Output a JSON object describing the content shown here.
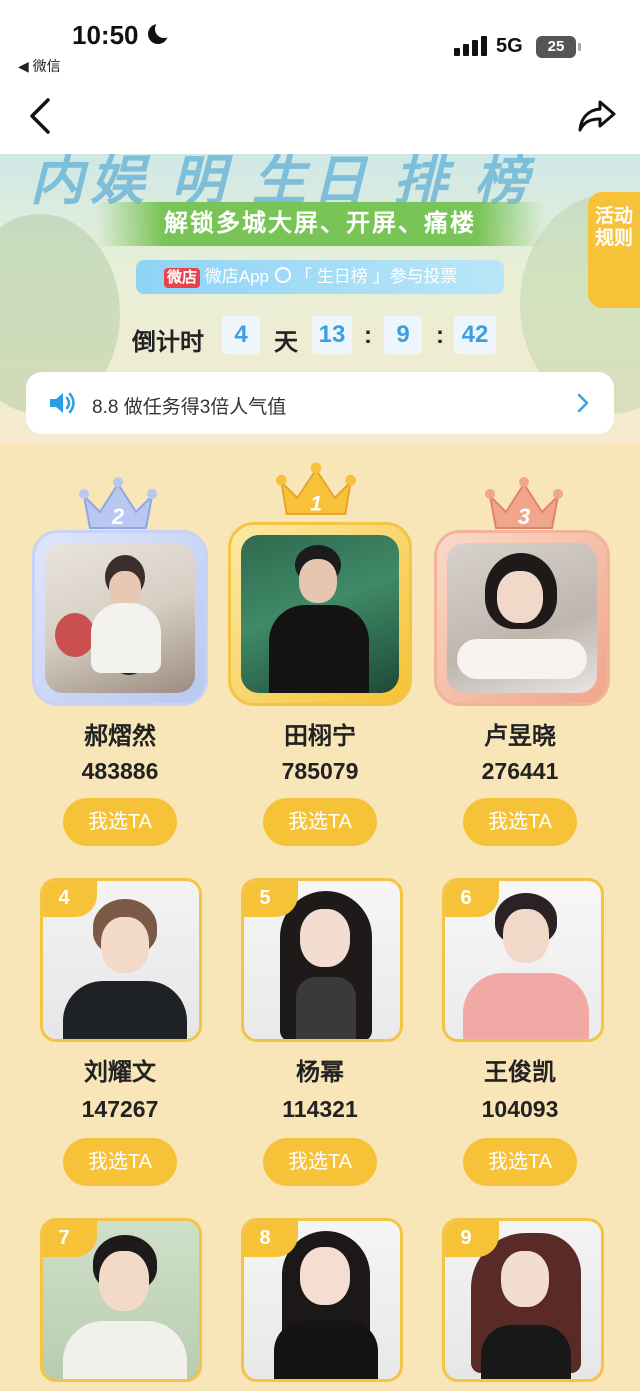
{
  "status_bar": {
    "time": "10:50",
    "back_app": "◀ 微信",
    "network": "5G",
    "battery": "25"
  },
  "banner": {
    "title_partial": "内娱 明 生日 排 榜",
    "subtitle": "解锁多城大屏、开屏、痛楼",
    "app_logo": "微店",
    "app_text_before": "微店App",
    "app_text_after": "「 生日榜 」参与投票",
    "countdown": {
      "label": "倒计时",
      "days": "4",
      "day_unit": "天",
      "hours": "13",
      "minutes": "9",
      "seconds": "42",
      "sep": ":"
    },
    "rules_tab": "活动规则"
  },
  "notice": {
    "text": "8.8 做任务得3倍人气值",
    "arrow": "›"
  },
  "vote_label": "我选TA",
  "top3": [
    {
      "rank": "2",
      "name": "郝熠然",
      "votes": "483886"
    },
    {
      "rank": "1",
      "name": "田栩宁",
      "votes": "785079"
    },
    {
      "rank": "3",
      "name": "卢昱晓",
      "votes": "276441"
    }
  ],
  "ranks": [
    {
      "rank": "4",
      "name": "刘耀文",
      "votes": "147267"
    },
    {
      "rank": "5",
      "name": "杨幂",
      "votes": "114321"
    },
    {
      "rank": "6",
      "name": "王俊凯",
      "votes": "104093"
    },
    {
      "rank": "7",
      "name": "",
      "votes": ""
    },
    {
      "rank": "8",
      "name": "",
      "votes": ""
    },
    {
      "rank": "9",
      "name": "",
      "votes": ""
    }
  ],
  "colors": {
    "gold": "#f6c338",
    "silver": "#b8c8f0",
    "bronze": "#f1a58a",
    "background": "#f8e6b8",
    "countdown_blue": "#3aa0e0"
  }
}
